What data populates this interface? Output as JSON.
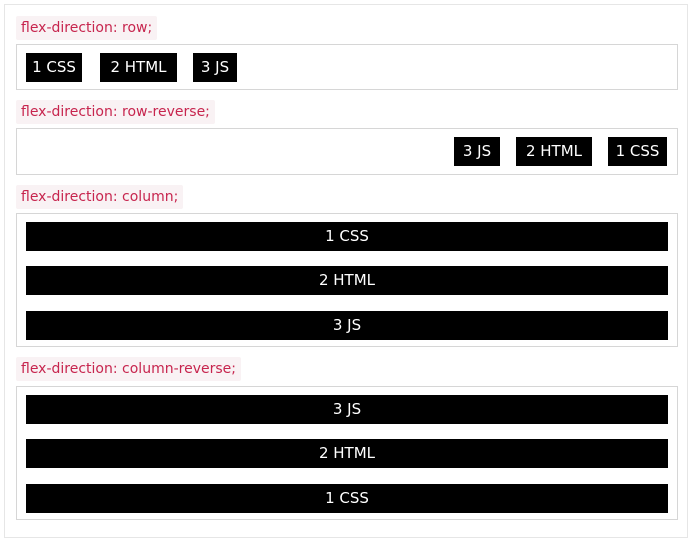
{
  "sections": [
    {
      "label": "flex-direction: row;",
      "items": [
        "1 CSS",
        "2 HTML",
        "3 JS"
      ]
    },
    {
      "label": "flex-direction: row-reverse;",
      "items": [
        "3 JS",
        "2 HTML",
        "1 CSS"
      ]
    },
    {
      "label": "flex-direction: column;",
      "items": [
        "1 CSS",
        "2 HTML",
        "3 JS"
      ]
    },
    {
      "label": "flex-direction: column-reverse;",
      "items": [
        "3 JS",
        "2 HTML",
        "1 CSS"
      ]
    }
  ],
  "colors": {
    "label_text": "#c7254e",
    "label_bg": "#f9f2f4",
    "item_bg": "#000000",
    "item_text": "#ffffff",
    "border": "#d6d6d6"
  }
}
